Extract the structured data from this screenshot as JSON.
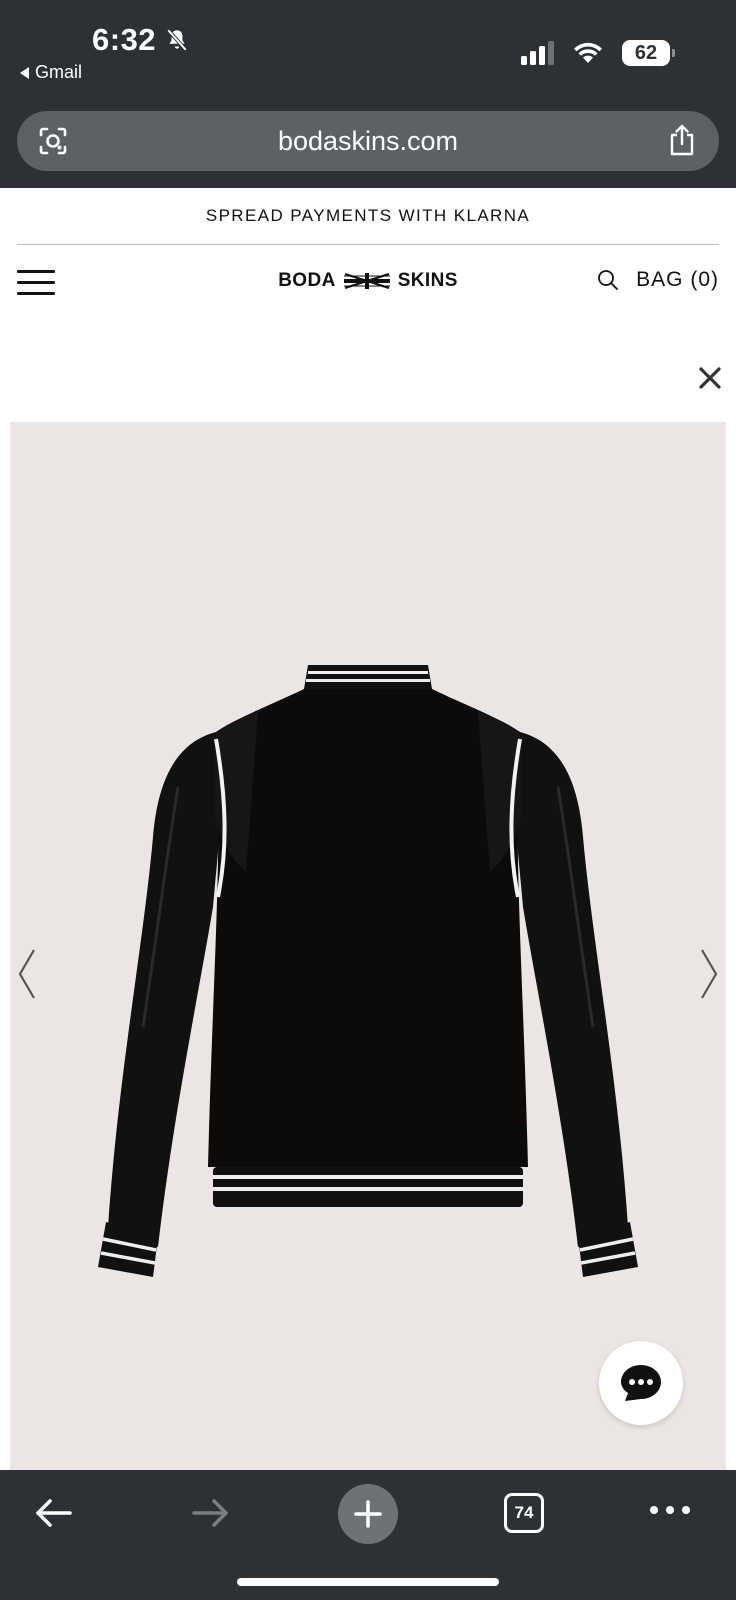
{
  "status_bar": {
    "time": "6:32",
    "back_app": "Gmail",
    "battery": "62"
  },
  "browser": {
    "url": "bodaskins.com",
    "open_tabs": "74"
  },
  "site": {
    "promo": "SPREAD PAYMENTS WITH KLARNA",
    "logo_left": "BODA",
    "logo_right": "SKINS",
    "bag_label": "BAG (0)"
  },
  "product_image": {
    "subject": "black varsity bomber jacket with black leather sleeves and white striped ribbing, back view"
  },
  "icons": [
    "bell-off-icon",
    "signal-icon",
    "wifi-icon",
    "battery-icon",
    "lens-icon",
    "share-icon",
    "menu-icon",
    "union-jack-icon",
    "search-icon",
    "close-icon",
    "chevron-left-icon",
    "chevron-right-icon",
    "chat-icon",
    "back-arrow-icon",
    "forward-arrow-icon",
    "plus-icon",
    "tabs-icon",
    "more-icon"
  ]
}
